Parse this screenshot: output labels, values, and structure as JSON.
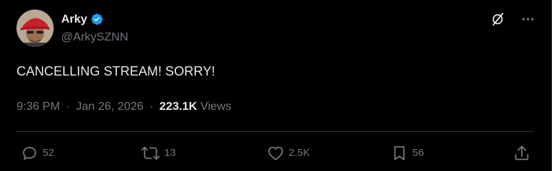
{
  "author": {
    "display_name": "Arky",
    "handle": "@ArkySZNN",
    "verified": true,
    "avatar": "profile-photo"
  },
  "tweet": {
    "text": "CANCELLING STREAM! SORRY!"
  },
  "meta": {
    "time": "9:36 PM",
    "separator": "·",
    "date": "Jan 26, 2026",
    "views_count": "223.1K",
    "views_label": "Views"
  },
  "actions": {
    "reply_count": "52",
    "retweet_count": "13",
    "like_count": "2.5K",
    "bookmark_count": "56"
  },
  "icons": {
    "verified": "verified-badge-icon",
    "grok": "grok-icon",
    "more": "more-options-icon",
    "reply": "reply-icon",
    "retweet": "retweet-icon",
    "like": "like-icon",
    "bookmark": "bookmark-icon",
    "share": "share-icon"
  },
  "colors": {
    "background": "#000000",
    "text_primary": "#e7e9ea",
    "text_secondary": "#71767b",
    "verified_blue": "#1d9bf0",
    "divider": "#2f3336"
  }
}
